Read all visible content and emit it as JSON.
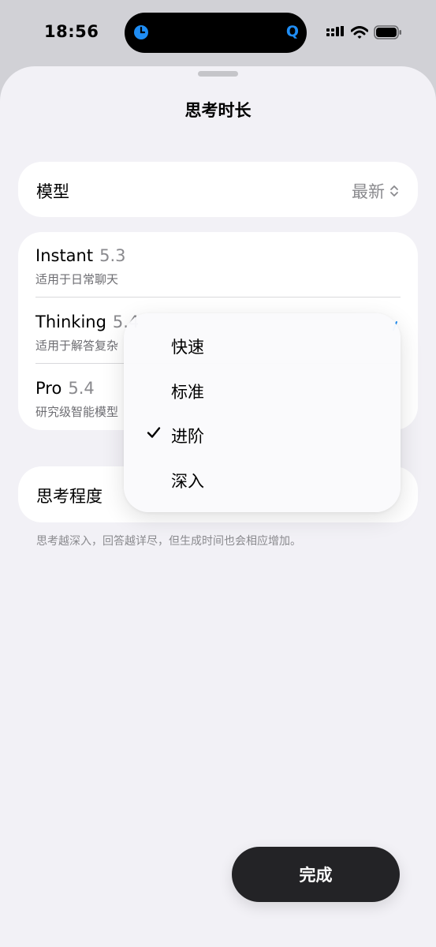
{
  "status_bar": {
    "time": "18:56",
    "island_right_glyph": "Q",
    "icons": [
      "cellular-signal-icon",
      "wifi-icon",
      "battery-icon"
    ],
    "accent_color": "#1f8df4"
  },
  "sheet": {
    "title": "思考时长"
  },
  "model_row": {
    "label": "模型",
    "value": "最新"
  },
  "models": [
    {
      "name": "Instant",
      "version": "5.3",
      "description": "适用于日常聊天"
    },
    {
      "name": "Thinking",
      "version": "5.4",
      "description": "适用于解答复杂"
    },
    {
      "name": "Pro",
      "version": "5.4",
      "description": "研究级智能模型"
    }
  ],
  "effort_row": {
    "label": "思考程度",
    "footnote": "思考越深入，回答越详尽，但生成时间也会相应增加。"
  },
  "effort_menu": {
    "options": [
      "快速",
      "标准",
      "进阶",
      "深入"
    ],
    "selected": "进阶"
  },
  "done_button": {
    "label": "完成",
    "background": "#232326"
  }
}
